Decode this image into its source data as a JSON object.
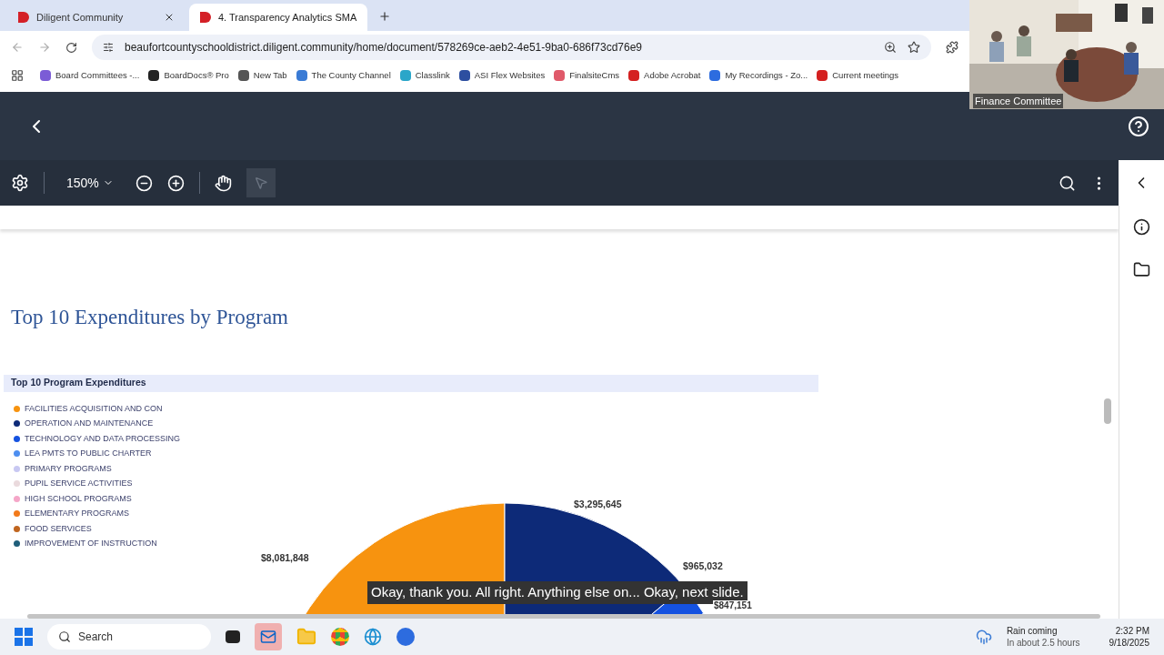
{
  "browser": {
    "tabs": [
      {
        "title": "Diligent Community",
        "selected": false
      },
      {
        "title": "4. Transparency Analytics SMA",
        "selected": true
      }
    ],
    "address": "beaufortcountyschooldistrict.diligent.community/home/document/578269ce-aeb2-4e51-9ba0-686f73cd76e9",
    "bookmarks": [
      "Board Committees -...",
      "BoardDocs® Pro",
      "New Tab",
      "The County Channel",
      "Classlink",
      "ASI Flex Websites",
      "FinalsiteCms",
      "Adobe Acrobat",
      "My Recordings - Zo...",
      "Current meetings"
    ]
  },
  "viewer": {
    "zoom": "150%"
  },
  "document": {
    "heading": "Top 10 Expenditures by Program",
    "panel_title": "Top 10 Program Expenditures",
    "legend": [
      {
        "label": "FACILITIES ACQUISITION AND CON",
        "color": "#f7930f"
      },
      {
        "label": "OPERATION AND MAINTENANCE",
        "color": "#0d2a78"
      },
      {
        "label": "TECHNOLOGY AND DATA PROCESSING",
        "color": "#1552e0"
      },
      {
        "label": "LEA PMTS TO PUBLIC CHARTER",
        "color": "#4d8ef0"
      },
      {
        "label": "PRIMARY PROGRAMS",
        "color": "#c8c8f2"
      },
      {
        "label": "PUPIL SERVICE ACTIVITIES",
        "color": "#eadadd"
      },
      {
        "label": "HIGH SCHOOL PROGRAMS",
        "color": "#f5a6c8"
      },
      {
        "label": "ELEMENTARY PROGRAMS",
        "color": "#f27a1a"
      },
      {
        "label": "FOOD SERVICES",
        "color": "#c0651f"
      },
      {
        "label": "IMPROVEMENT OF INSTRUCTION",
        "color": "#1f5e7a"
      }
    ],
    "slice_labels": [
      "$8,081,848",
      "$3,295,645",
      "$965,032",
      "$847,151"
    ]
  },
  "video": {
    "label": "Finance Committee"
  },
  "caption": "Okay, thank you. All right. Anything else on... Okay, next slide.",
  "taskbar": {
    "search": "Search",
    "weather_title": "Rain coming",
    "weather_detail": "In about 2.5 hours",
    "time": "2:32 PM",
    "date": "9/18/2025"
  }
}
